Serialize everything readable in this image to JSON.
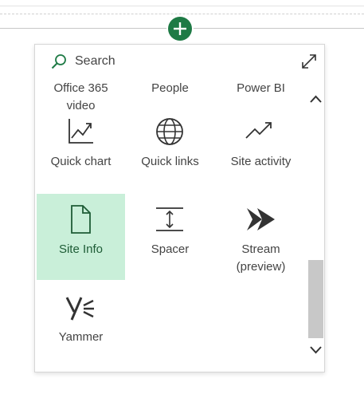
{
  "search": {
    "placeholder": "Search"
  },
  "webparts": {
    "row0": [
      "Office 365 video",
      "People",
      "Power BI"
    ],
    "row0_visible": [
      "Office 365",
      "video"
    ],
    "row1": [
      "Quick chart",
      "Quick links",
      "Site activity"
    ],
    "row2": [
      "Site Info",
      "Spacer",
      "Stream (preview)"
    ],
    "row2_stream_lines": [
      "Stream",
      "(preview)"
    ],
    "row3": [
      "Yammer"
    ]
  },
  "selected": "Site Info",
  "colors": {
    "accent": "#1e7a45",
    "selected_bg": "#c9efd9",
    "icon": "#333333"
  },
  "icons": {
    "add": "plus-circle-icon",
    "search": "search-icon",
    "expand": "expand-icon",
    "quick_chart": "line-chart-icon",
    "quick_links": "globe-icon",
    "site_activity": "trend-icon",
    "site_info": "page-icon",
    "spacer": "spacer-icon",
    "stream": "stream-icon",
    "yammer": "yammer-icon"
  }
}
